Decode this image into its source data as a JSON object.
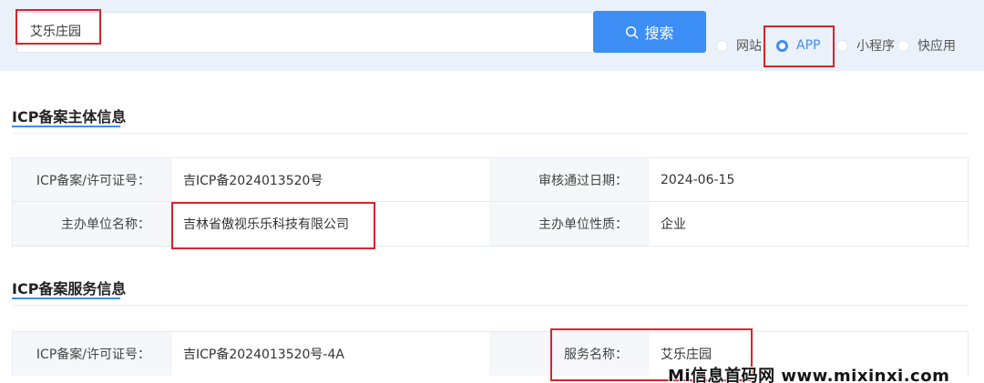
{
  "search": {
    "value": "艾乐庄园",
    "button_label": "搜索"
  },
  "filters": {
    "options": [
      "网站",
      "APP",
      "小程序",
      "快应用"
    ],
    "selected": "APP"
  },
  "subject_section": {
    "title": "ICP备案主体信息",
    "rows": [
      {
        "label1": "ICP备案/许可证号：",
        "value1": "吉ICP备2024013520号",
        "label2": "审核通过日期：",
        "value2": "2024-06-15"
      },
      {
        "label1": "主办单位名称：",
        "value1": "吉林省傲视乐乐科技有限公司",
        "label2": "主办单位性质：",
        "value2": "企业"
      }
    ]
  },
  "service_section": {
    "title": "ICP备案服务信息",
    "rows": [
      {
        "label1": "ICP备案/许可证号：",
        "value1": "吉ICP备2024013520号-4A",
        "label2": "服务名称：",
        "value2": "艾乐庄园"
      }
    ]
  },
  "watermark": "Mi信息首码网 www.mixinxi.com",
  "colors": {
    "accent": "#3d8ef5",
    "highlight": "#d9232c",
    "topbar": "#eaf1fa"
  }
}
